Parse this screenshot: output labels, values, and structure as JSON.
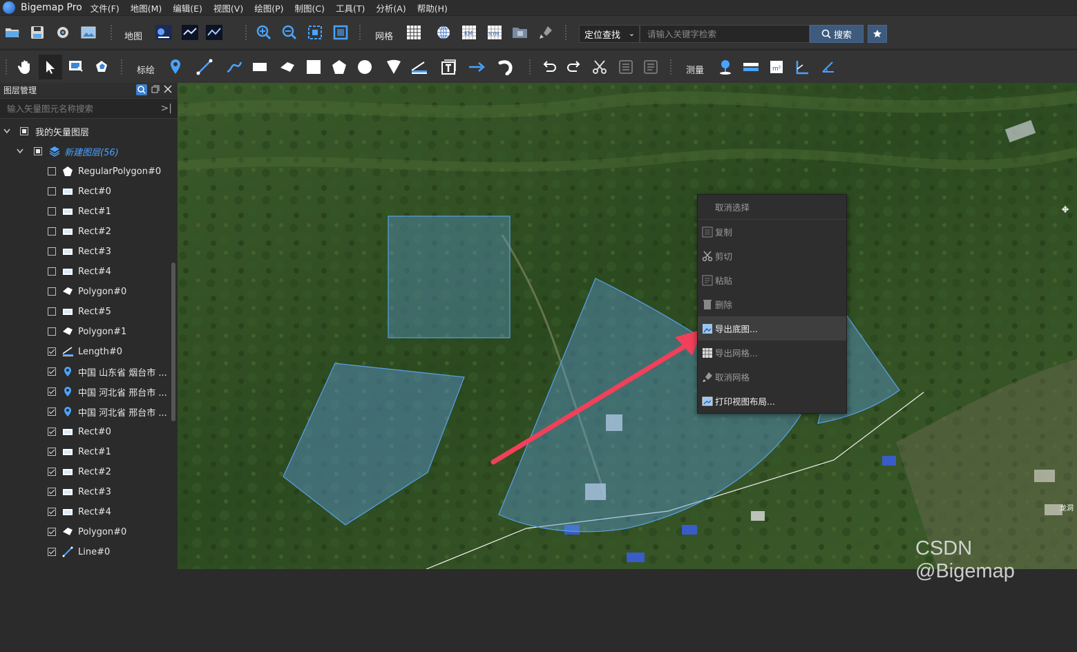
{
  "app": {
    "title": "Bigemap Pro"
  },
  "menu": [
    "文件(F)",
    "地图(M)",
    "编辑(E)",
    "视图(V)",
    "绘图(P)",
    "制图(C)",
    "工具(T)",
    "分析(A)",
    "帮助(H)"
  ],
  "toolbar1": {
    "map_label": "地图",
    "grid_label": "网格",
    "locate_label": "定位查找",
    "search_placeholder": "请输入关键字检索",
    "search_button": "搜索"
  },
  "toolbar2": {
    "draw_label": "标绘",
    "measure_label": "测量"
  },
  "layer_panel": {
    "title": "图层管理",
    "search_placeholder": "输入矢量图元名称搜索",
    "root": {
      "label": "我的矢量图层"
    },
    "group": {
      "label": "新建图层(56)"
    },
    "items": [
      {
        "label": "RegularPolygon#0",
        "icon": "regular-polygon-icon",
        "checked": false
      },
      {
        "label": "Rect#0",
        "icon": "rect-icon",
        "checked": false
      },
      {
        "label": "Rect#1",
        "icon": "rect-icon",
        "checked": false
      },
      {
        "label": "Rect#2",
        "icon": "rect-icon",
        "checked": false
      },
      {
        "label": "Rect#3",
        "icon": "rect-icon",
        "checked": false
      },
      {
        "label": "Rect#4",
        "icon": "rect-icon",
        "checked": false
      },
      {
        "label": "Polygon#0",
        "icon": "polygon-icon",
        "checked": false
      },
      {
        "label": "Rect#5",
        "icon": "rect-icon",
        "checked": false
      },
      {
        "label": "Polygon#1",
        "icon": "polygon-icon",
        "checked": false
      },
      {
        "label": "Length#0",
        "icon": "length-icon",
        "checked": true
      },
      {
        "label": "中国 山东省 烟台市 ...",
        "icon": "marker-icon",
        "checked": true
      },
      {
        "label": "中国 河北省 邢台市 ...",
        "icon": "marker-icon",
        "checked": true
      },
      {
        "label": "中国 河北省 邢台市 ...",
        "icon": "marker-icon",
        "checked": true
      },
      {
        "label": "Rect#0",
        "icon": "rect-icon",
        "checked": true
      },
      {
        "label": "Rect#1",
        "icon": "rect-icon",
        "checked": true
      },
      {
        "label": "Rect#2",
        "icon": "rect-icon",
        "checked": true
      },
      {
        "label": "Rect#3",
        "icon": "rect-icon",
        "checked": true
      },
      {
        "label": "Rect#4",
        "icon": "rect-icon",
        "checked": true
      },
      {
        "label": "Polygon#0",
        "icon": "polygon-icon",
        "checked": true
      },
      {
        "label": "Line#0",
        "icon": "line-icon",
        "checked": true
      }
    ]
  },
  "context_menu": {
    "items": [
      {
        "label": "取消选择",
        "icon": "",
        "enabled": false
      },
      {
        "label": "复制",
        "icon": "copy-icon",
        "enabled": false
      },
      {
        "label": "剪切",
        "icon": "cut-icon",
        "enabled": false
      },
      {
        "label": "粘贴",
        "icon": "paste-icon",
        "enabled": false
      },
      {
        "label": "删除",
        "icon": "delete-icon",
        "enabled": false
      },
      {
        "label": "导出底图...",
        "icon": "export-map-icon",
        "enabled": true
      },
      {
        "label": "导出网格...",
        "icon": "export-grid-icon",
        "enabled": false
      },
      {
        "label": "取消网格",
        "icon": "cancel-grid-icon",
        "enabled": false
      },
      {
        "label": "打印视图布局...",
        "icon": "print-layout-icon",
        "enabled": true
      }
    ]
  },
  "map": {
    "place_label": "龙洞"
  },
  "watermark": "CSDN @Bigemap",
  "colors": {
    "accent": "#3e5a7d",
    "shape_fill": "#4a88c7",
    "arrow": "#f0405a"
  }
}
